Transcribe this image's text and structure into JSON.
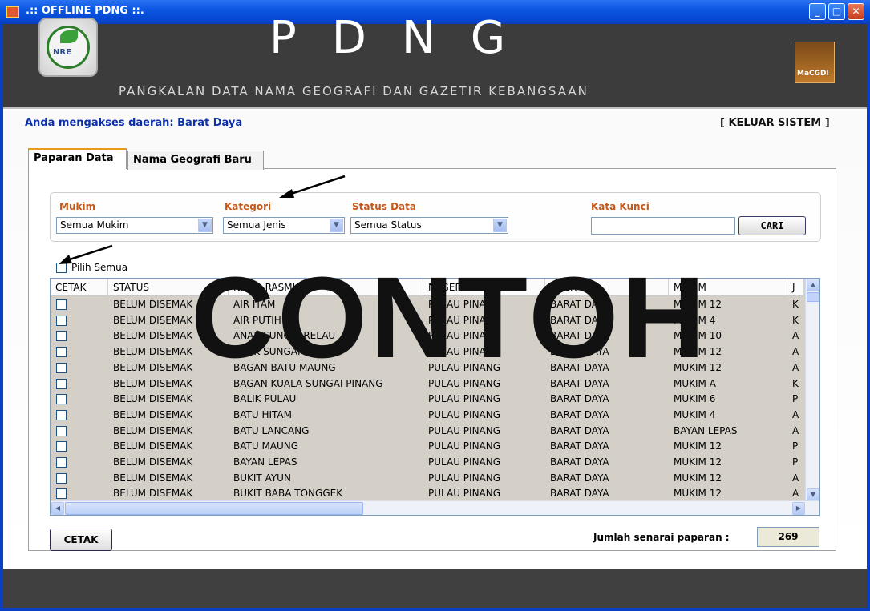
{
  "window": {
    "title": ".:: OFFLINE PDNG ::.",
    "controls": [
      "minimize",
      "maximize",
      "close"
    ]
  },
  "banner": {
    "title": "PDNG",
    "subtitle": "PANGKALAN DATA NAMA GEOGRAFI DAN GAZETIR KEBANGSAAN",
    "left_logo_text": "NRE",
    "right_logo_text": "MaCGDI"
  },
  "header": {
    "access_text": "Anda mengakses daerah: Barat Daya",
    "logout_label": "[ KELUAR SISTEM ]"
  },
  "tabs": [
    {
      "label": "Paparan Data",
      "active": true
    },
    {
      "label": "Nama Geografi Baru",
      "active": false
    }
  ],
  "filters": {
    "mukim": {
      "label": "Mukim",
      "value": "Semua Mukim"
    },
    "kategori": {
      "label": "Kategori",
      "value": "Semua Jenis"
    },
    "status": {
      "label": "Status Data",
      "value": "Semua Status"
    },
    "kata_kunci": {
      "label": "Kata Kunci",
      "value": ""
    },
    "search_label": "CARI"
  },
  "select_all_label": "Pilih Semua",
  "table": {
    "columns": [
      "CETAK",
      "STATUS",
      "NAMA RASMI",
      "NEGERI",
      "DAERAH",
      "MUKIM",
      "J"
    ],
    "rows": [
      {
        "status": "BELUM DISEMAK",
        "nama": "AIR ITAM",
        "negeri": "PULAU PINANG",
        "daerah": "BARAT DAYA",
        "mukim": "MUKIM 12",
        "j": "K"
      },
      {
        "status": "BELUM DISEMAK",
        "nama": "AIR PUTIH",
        "negeri": "PULAU PINANG",
        "daerah": "BARAT DAYA",
        "mukim": "MUKIM 4",
        "j": "K"
      },
      {
        "status": "BELUM DISEMAK",
        "nama": "ANAK SUNGAI RELAU",
        "negeri": "PULAU PINANG",
        "daerah": "BARAT DAYA",
        "mukim": "MUKIM 10",
        "j": "A"
      },
      {
        "status": "BELUM DISEMAK",
        "nama": "ANAK SUNGAI RELAU",
        "negeri": "PULAU PINANG",
        "daerah": "BARAT DAYA",
        "mukim": "MUKIM 12",
        "j": "A"
      },
      {
        "status": "BELUM DISEMAK",
        "nama": "BAGAN BATU MAUNG",
        "negeri": "PULAU PINANG",
        "daerah": "BARAT DAYA",
        "mukim": "MUKIM 12",
        "j": "A"
      },
      {
        "status": "BELUM DISEMAK",
        "nama": "BAGAN KUALA SUNGAI PINANG",
        "negeri": "PULAU PINANG",
        "daerah": "BARAT DAYA",
        "mukim": "MUKIM A",
        "j": "K"
      },
      {
        "status": "BELUM DISEMAK",
        "nama": "BALIK PULAU",
        "negeri": "PULAU PINANG",
        "daerah": "BARAT DAYA",
        "mukim": "MUKIM 6",
        "j": "P"
      },
      {
        "status": "BELUM DISEMAK",
        "nama": "BATU HITAM",
        "negeri": "PULAU PINANG",
        "daerah": "BARAT DAYA",
        "mukim": "MUKIM 4",
        "j": "A"
      },
      {
        "status": "BELUM DISEMAK",
        "nama": "BATU LANCANG",
        "negeri": "PULAU PINANG",
        "daerah": "BARAT DAYA",
        "mukim": "BAYAN LEPAS",
        "j": "A"
      },
      {
        "status": "BELUM DISEMAK",
        "nama": "BATU MAUNG",
        "negeri": "PULAU PINANG",
        "daerah": "BARAT DAYA",
        "mukim": "MUKIM 12",
        "j": "P"
      },
      {
        "status": "BELUM DISEMAK",
        "nama": "BAYAN LEPAS",
        "negeri": "PULAU PINANG",
        "daerah": "BARAT DAYA",
        "mukim": "MUKIM 12",
        "j": "P"
      },
      {
        "status": "BELUM DISEMAK",
        "nama": "BUKIT AYUN",
        "negeri": "PULAU PINANG",
        "daerah": "BARAT DAYA",
        "mukim": "MUKIM 12",
        "j": "A"
      },
      {
        "status": "BELUM DISEMAK",
        "nama": "BUKIT BABA TONGGEK",
        "negeri": "PULAU PINANG",
        "daerah": "BARAT DAYA",
        "mukim": "MUKIM 12",
        "j": "A"
      }
    ]
  },
  "print_label": "CETAK",
  "count": {
    "label": "Jumlah senarai paparan :",
    "value": "269"
  },
  "watermark": "CONTOH",
  "colors": {
    "titlebar": "#0b56e0",
    "banner": "#3c3c3c",
    "filter_label": "#c4581a",
    "access_text": "#0b2fa8",
    "grid_row": "#d4d0c8"
  }
}
